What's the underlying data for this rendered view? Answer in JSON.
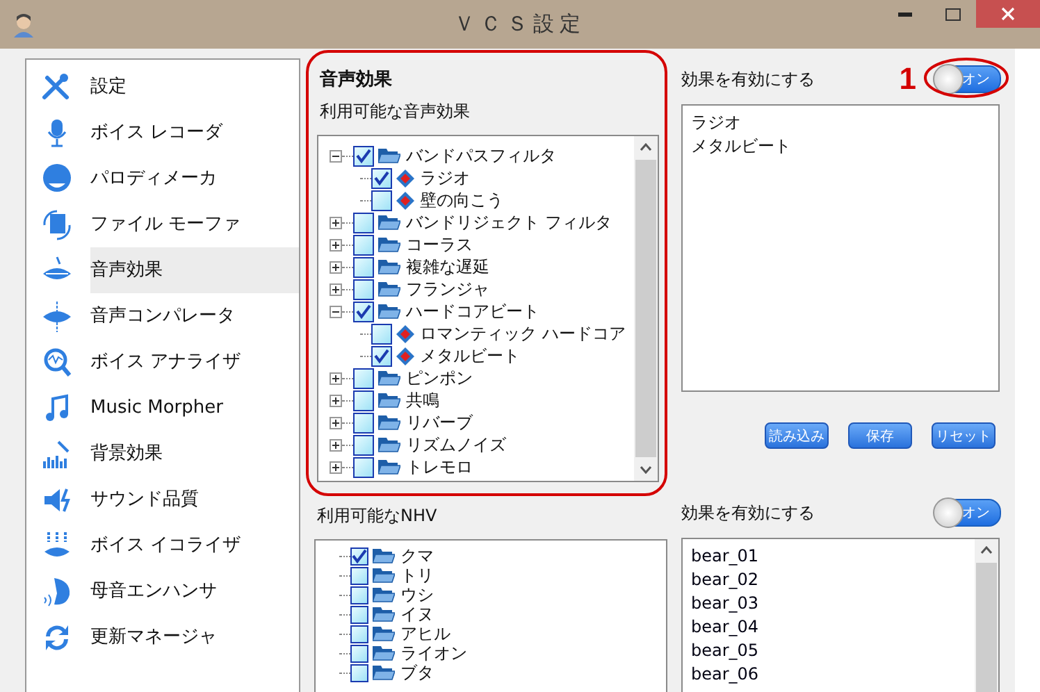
{
  "window": {
    "title": "ＶＣＳ設定"
  },
  "sidebar": {
    "items": [
      {
        "label": "設定",
        "selected": false
      },
      {
        "label": "ボイス レコーダ",
        "selected": false
      },
      {
        "label": "パロディメーカ",
        "selected": false
      },
      {
        "label": "ファイル モーファ",
        "selected": false
      },
      {
        "label": "音声効果",
        "selected": true
      },
      {
        "label": "音声コンパレータ",
        "selected": false
      },
      {
        "label": "ボイス アナライザ",
        "selected": false
      },
      {
        "label": "Music Morpher",
        "selected": false
      },
      {
        "label": "背景効果",
        "selected": false
      },
      {
        "label": "サウンド品質",
        "selected": false
      },
      {
        "label": "ボイス イコライザ",
        "selected": false
      },
      {
        "label": "母音エンハンサ",
        "selected": false
      },
      {
        "label": "更新マネージャ",
        "selected": false
      }
    ]
  },
  "effects_panel": {
    "title": "音声効果",
    "highlighted": true,
    "available_label": "利用可能な音声効果",
    "tree": [
      {
        "label": "バンドパスフィルタ",
        "checked": true,
        "expanded": true,
        "children": [
          {
            "label": "ラジオ",
            "checked": true
          },
          {
            "label": "壁の向こう",
            "checked": false
          }
        ]
      },
      {
        "label": "バンドリジェクト フィルタ",
        "checked": false,
        "expanded": false
      },
      {
        "label": "コーラス",
        "checked": false,
        "expanded": false
      },
      {
        "label": "複雑な遅延",
        "checked": false,
        "expanded": false
      },
      {
        "label": "フランジャ",
        "checked": false,
        "expanded": false
      },
      {
        "label": "ハードコアビート",
        "checked": true,
        "expanded": true,
        "children": [
          {
            "label": "ロマンティック ハードコア",
            "checked": false
          },
          {
            "label": "メタルビート",
            "checked": true
          }
        ]
      },
      {
        "label": "ピンポン",
        "checked": false,
        "expanded": false
      },
      {
        "label": "共鳴",
        "checked": false,
        "expanded": false
      },
      {
        "label": "リバーブ",
        "checked": false,
        "expanded": false
      },
      {
        "label": "リズムノイズ",
        "checked": false,
        "expanded": false
      },
      {
        "label": "トレモロ",
        "checked": false,
        "expanded": false
      }
    ]
  },
  "enabled_effects": {
    "label": "効果を有効にする",
    "callout": "1",
    "toggle": {
      "on": true,
      "label": "オン",
      "highlighted": true
    },
    "items": [
      "ラジオ",
      "メタルビート"
    ]
  },
  "buttons": [
    "読み込み",
    "保存",
    "リセット"
  ],
  "nhv_panel": {
    "available_label": "利用可能なNHV",
    "tree": [
      {
        "label": "クマ",
        "checked": true
      },
      {
        "label": "トリ",
        "checked": false
      },
      {
        "label": "ウシ",
        "checked": false
      },
      {
        "label": "イヌ",
        "checked": false
      },
      {
        "label": "アヒル",
        "checked": false
      },
      {
        "label": "ライオン",
        "checked": false
      },
      {
        "label": "ブタ",
        "checked": false
      }
    ]
  },
  "enabled_nhv": {
    "label": "効果を有効にする",
    "toggle": {
      "on": true,
      "label": "オン"
    },
    "items": [
      "bear_01",
      "bear_02",
      "bear_03",
      "bear_04",
      "bear_05",
      "bear_06"
    ]
  }
}
